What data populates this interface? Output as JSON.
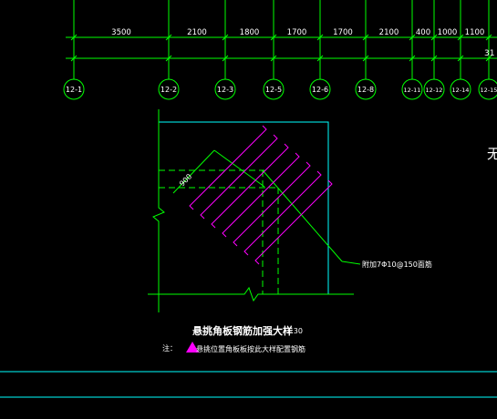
{
  "colors": {
    "background": "#000000",
    "grid": "#00FF00",
    "cyan": "#00FFFF",
    "magenta": "#FF00FF",
    "white": "#FFFFFF",
    "yellow": "#FFFF00"
  },
  "dimensions": {
    "spacings": [
      "3500",
      "2100",
      "1800",
      "1700",
      "1700",
      "2100",
      "400",
      "1000",
      "1100"
    ],
    "second_row_fragment": "31",
    "diagonal_dim": "900"
  },
  "axes": {
    "labels": [
      "12-1",
      "12-2",
      "12-3",
      "12-5",
      "12-6",
      "12-8",
      "12-11",
      "12-12",
      "12-14",
      "12-15"
    ]
  },
  "detail": {
    "title": "悬挑角板钢筋加强大样",
    "scale": "1:30",
    "rebar_note": "附加7Φ10@150面筋",
    "right_fragment": "无",
    "note_prefix": "注：",
    "note_text": "悬挑位置角板板按此大样配置钢筋"
  }
}
